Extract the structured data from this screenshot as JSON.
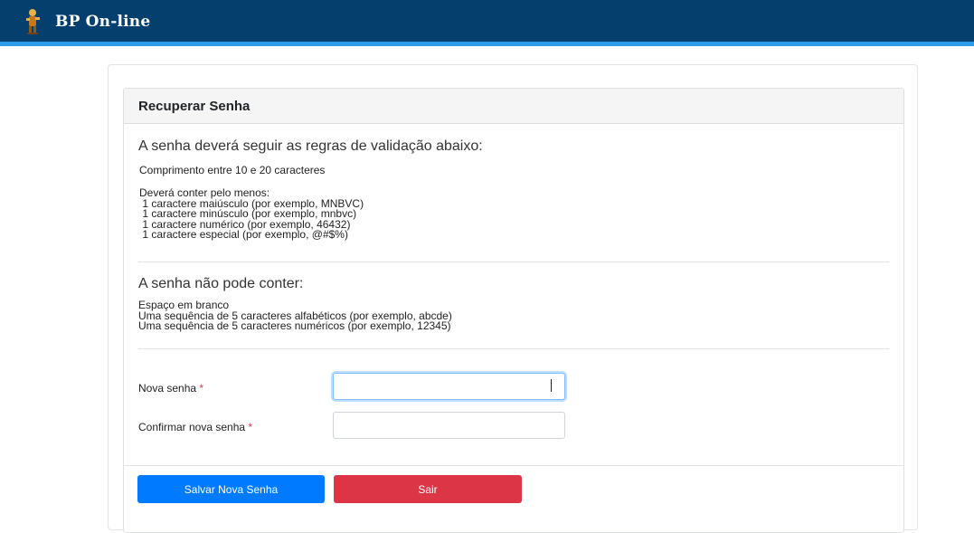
{
  "app": {
    "title": "BP On-line",
    "logo_icon": "person-figure-icon",
    "header_color": "#053f6d",
    "accent_color": "#2e9be8"
  },
  "card": {
    "title": "Recuperar Senha"
  },
  "rules": {
    "heading": "A senha deverá seguir as regras de validação abaixo:",
    "length": "Comprimento entre 10 e 20 caracteres",
    "must_title": "Deverá conter pelo menos:",
    "must_items": [
      " 1 caractere maiúsculo (por exemplo, MNBVC)",
      " 1 caractere minúsculo (por exemplo, mnbvc)",
      " 1 caractere numérico (por exemplo, 46432)",
      " 1 caractere especial (por exemplo, @#$%)"
    ]
  },
  "forbidden": {
    "heading": "A senha não pode conter:",
    "items": [
      "Espaço em branco",
      "Uma sequência de 5 caracteres alfabéticos (por exemplo, abcde)",
      "Uma sequência de 5 caracteres numéricos (por exemplo, 12345)"
    ]
  },
  "form": {
    "new_password_label": "Nova senha",
    "confirm_password_label": "Confirmar nova senha",
    "required_mark": "*",
    "new_password_value": "",
    "confirm_password_value": ""
  },
  "buttons": {
    "save_label": "Salvar Nova Senha",
    "exit_label": "Sair",
    "save_color": "#007bff",
    "exit_color": "#dc3545"
  }
}
